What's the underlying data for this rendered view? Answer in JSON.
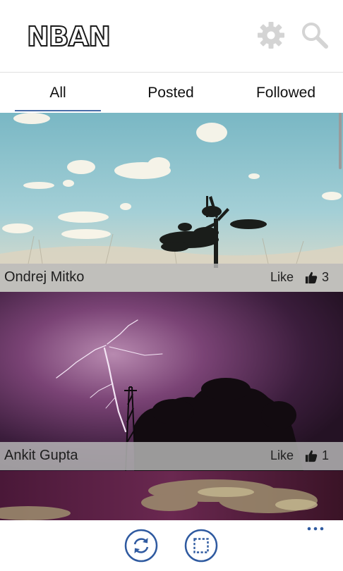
{
  "app": {
    "title": "NBAN"
  },
  "header": {
    "settings_icon": "gear-icon",
    "search_icon": "search-icon"
  },
  "tabs": [
    {
      "label": "All",
      "selected": true
    },
    {
      "label": "Posted",
      "selected": false
    },
    {
      "label": "Followed",
      "selected": false
    }
  ],
  "posts": [
    {
      "author": "Ondrej Mitko",
      "like_label": "Like",
      "likes": "3",
      "image": "lone tree under blue sky with clouds"
    },
    {
      "author": "Ankit Gupta",
      "like_label": "Like",
      "likes": "1",
      "image": "purple lightning over radio tower and trees"
    },
    {
      "image": "dark magenta stormy sky"
    }
  ],
  "appbar": {
    "refresh_icon": "refresh-icon",
    "select_icon": "select-icon",
    "more_icon": "more-icon"
  },
  "colors": {
    "accent": "#4a6da7",
    "appbar_icon": "#2f5aa0"
  }
}
